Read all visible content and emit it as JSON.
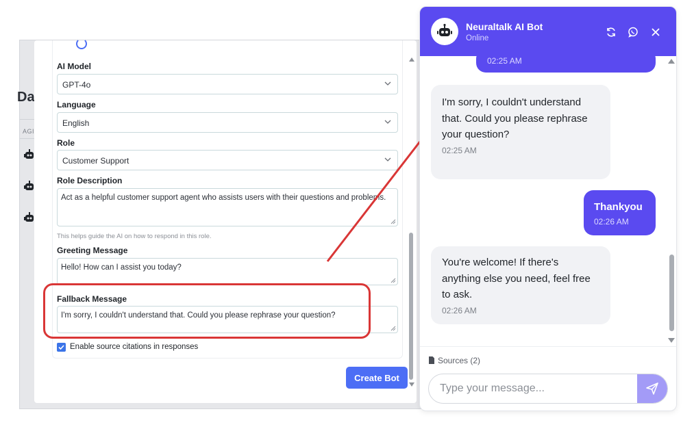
{
  "dashboard": {
    "heading_fragment": "Das",
    "column_header_fragment": "AGI"
  },
  "form": {
    "ai_model": {
      "label": "AI Model",
      "value": "GPT-4o"
    },
    "language": {
      "label": "Language",
      "value": "English"
    },
    "role": {
      "label": "Role",
      "value": "Customer Support"
    },
    "role_description": {
      "label": "Role Description",
      "value": "Act as a helpful customer support agent who assists users with their questions and problems.",
      "hint": "This helps guide the AI on how to respond in this role."
    },
    "greeting_message": {
      "label": "Greeting Message",
      "value": "Hello! How can I assist you today?"
    },
    "fallback_message": {
      "label": "Fallback Message",
      "value": "I'm sorry, I couldn't understand that. Could you please rephrase your question?"
    },
    "source_citations": {
      "label": "Enable source citations in responses",
      "checked": true
    },
    "create_button": "Create Bot"
  },
  "chat": {
    "bot_name": "Neuraltalk AI Bot",
    "status": "Online",
    "messages": [
      {
        "from": "user",
        "text": "",
        "time": "02:25 AM"
      },
      {
        "from": "bot",
        "text": "I'm sorry, I couldn't understand that. Could you please rephrase your question?",
        "time": "02:25 AM"
      },
      {
        "from": "user",
        "text": "Thankyou",
        "time": "02:26 AM"
      },
      {
        "from": "bot",
        "text": "You're welcome! If there's anything else you need, feel free to ask.",
        "time": "02:26 AM"
      }
    ],
    "sources_label": "Sources (2)",
    "input_placeholder": "Type your message..."
  },
  "colors": {
    "accent": "#5a4af0",
    "primary_button": "#4c6ef5",
    "annotation": "#d93636"
  },
  "icons": [
    "robot-icon",
    "refresh-icon",
    "whatsapp-icon",
    "close-icon",
    "document-icon",
    "send-icon",
    "chevron-down-icon",
    "check-icon"
  ]
}
